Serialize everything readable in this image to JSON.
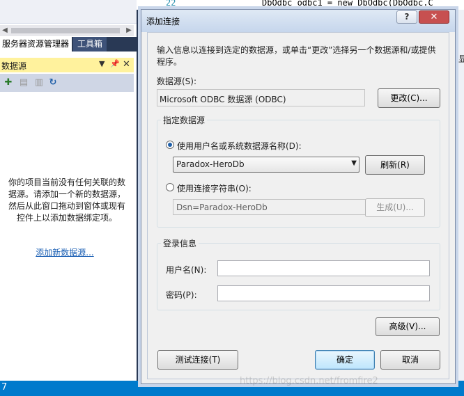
{
  "ide": {
    "tab_server_explorer": "服务器资源管理器",
    "tab_toolbox": "工具箱",
    "panel_title": "数据源",
    "pin_glyph": "▾ ꟾ ✕",
    "empty_message": "你的项目当前没有任何关联的数据源。请添加一个新的数据源，然后从此窗口拖动到窗体或现有控件上以添加数据绑定项。",
    "add_datasource_link": "添加新数据源...",
    "status_number": "7",
    "code_line_number": "22",
    "code_text": "DbOdbc odbc1 = new DbOdbc(DbOdbc.C",
    "right_panel_char": "显"
  },
  "dialog": {
    "title": "添加连接",
    "help_label": "?",
    "close_label": "✕",
    "intro": "输入信息以连接到选定的数据源，或单击“更改”选择另一个数据源和/或提供程序。",
    "datasource_label": "数据源(S):",
    "datasource_value": "Microsoft ODBC 数据源 (ODBC)",
    "change_button": "更改(C)...",
    "specify_group_title": "指定数据源",
    "radio_dsn_label": "使用用户名或系统数据源名称(D):",
    "dsn_selected": "Paradox-HeroDb",
    "refresh_button": "刷新(R)",
    "radio_connstr_label": "使用连接字符串(O):",
    "connstr_value": "Dsn=Paradox-HeroDb",
    "build_button": "生成(U)...",
    "login_group_title": "登录信息",
    "username_label": "用户名(N):",
    "username_value": "",
    "password_label": "密码(P):",
    "password_value": "",
    "advanced_button": "高级(V)...",
    "test_button": "测试连接(T)",
    "ok_button": "确定",
    "cancel_button": "取消"
  },
  "watermark": "https://blog.csdn.net/fromfire2"
}
